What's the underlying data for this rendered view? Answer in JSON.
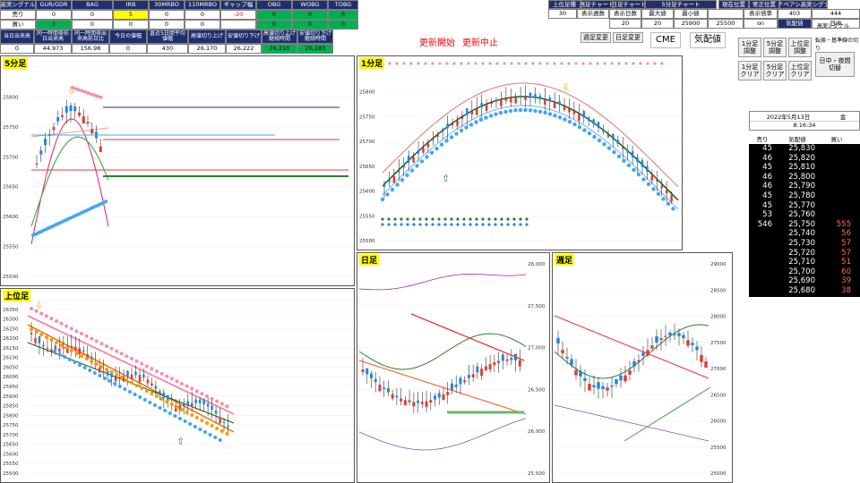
{
  "header": {
    "row1": [
      "高実シグナル",
      "GUR/GDR",
      "BAG",
      "IRB",
      "30MRBO",
      "110MRBO",
      "ギャップ幅",
      "OBG",
      "WOBG",
      "TOBG"
    ],
    "row2_label": "売り",
    "row2": [
      "0",
      "0",
      "5",
      "0",
      "0",
      "-20",
      "0",
      "0",
      "0"
    ],
    "row3_label": "買い",
    "row3": [
      "2",
      "0",
      "0",
      "0",
      "0",
      "",
      "0",
      "0",
      "0"
    ],
    "row4": [
      "当日出来高",
      "同一時間帯前日出来高",
      "同一時間帯出来高前日比",
      "今日の値幅",
      "直近5日間平均値幅",
      "高値切り上げ",
      "安値切り下げ",
      "高値切り上げ継続時間",
      "安値切り下げ継続時間"
    ],
    "row5": [
      "0",
      "44,973",
      "156.98",
      "0",
      "430",
      "26,170",
      "26,222",
      "26,210",
      "26,183"
    ]
  },
  "top_right": {
    "labels": [
      "上位足種",
      "週足チャート",
      "日足チャート",
      "5分足チャート",
      "現在位置",
      "寄正位置",
      "ナベアシ高実シグナ"
    ],
    "values": [
      "30",
      "表示週数",
      "表示日数",
      "最大値",
      "最小値",
      "",
      "表示倍率",
      "403",
      "444"
    ],
    "row3": [
      "20",
      "20",
      "25900",
      "25500",
      "on",
      "気配値",
      "日中"
    ]
  },
  "buttons": {
    "start": "更新開始",
    "stop": "更新中止",
    "upper_change": "週足変更",
    "daily_change": "日足変更",
    "cme": "CME",
    "kehai": "気配値",
    "m1_adj": "1分足\n調整",
    "m5_adj": "5分足\n調整",
    "upper_adj": "上位足\n調整",
    "m1_clear": "1分足\nクリア",
    "m5_clear": "5分足\nクリア",
    "upper_clear": "上位足\nクリア",
    "session": "日中・夜間\n切替",
    "lookup": "転換・基準線の切り",
    "signal_on": "高実シグナル"
  },
  "date": {
    "date": "2022年5月13日",
    "weekday": "金",
    "time": "8:16:34"
  },
  "orderbook": {
    "headers": [
      "売り",
      "気配値",
      "買い"
    ],
    "rows": [
      [
        "45",
        "25,830",
        ""
      ],
      [
        "46",
        "25,820",
        ""
      ],
      [
        "45",
        "25,810",
        ""
      ],
      [
        "46",
        "25,800",
        ""
      ],
      [
        "46",
        "25,790",
        ""
      ],
      [
        "45",
        "25,780",
        ""
      ],
      [
        "45",
        "25,770",
        ""
      ],
      [
        "53",
        "25,760",
        ""
      ],
      [
        "546",
        "25,750",
        "555"
      ],
      [
        "",
        "25,740",
        "56"
      ],
      [
        "",
        "25,730",
        "57"
      ],
      [
        "",
        "25,720",
        "57"
      ],
      [
        "",
        "25,710",
        "51"
      ],
      [
        "",
        "25,700",
        "60"
      ],
      [
        "",
        "25,690",
        "39"
      ],
      [
        "",
        "25,680",
        "38"
      ]
    ]
  },
  "charts": {
    "m5_title": "5分足",
    "m1_title": "1分足",
    "upper_title": "上位足",
    "daily_title": "日足",
    "weekly_title": "週足",
    "m5_yticks": [
      "25850",
      "25800",
      "25750",
      "25700",
      "25650",
      "25600",
      "25550",
      "25500"
    ],
    "m1_yticks": [
      "25850",
      "25800",
      "25750",
      "25700",
      "25650",
      "25600",
      "25550",
      "25500"
    ],
    "upper_yticks": [
      "26400",
      "26350",
      "26300",
      "26250",
      "26200",
      "26150",
      "26100",
      "26050",
      "26000",
      "25950",
      "25900",
      "25850",
      "25800",
      "25750",
      "25700",
      "25650",
      "25600",
      "25550",
      "25500"
    ],
    "daily_yticks": [
      "28,000",
      "27,500",
      "27,000",
      "26,500",
      "26,000",
      "25,500"
    ],
    "weekly_yticks": [
      "29000",
      "28500",
      "28000",
      "27500",
      "27000",
      "26500",
      "26000",
      "25500",
      "25000"
    ]
  },
  "colors": {
    "navy": "#1f2f6e",
    "yellow": "#ffff00",
    "green": "#00b050",
    "black_panel": "#000000"
  }
}
